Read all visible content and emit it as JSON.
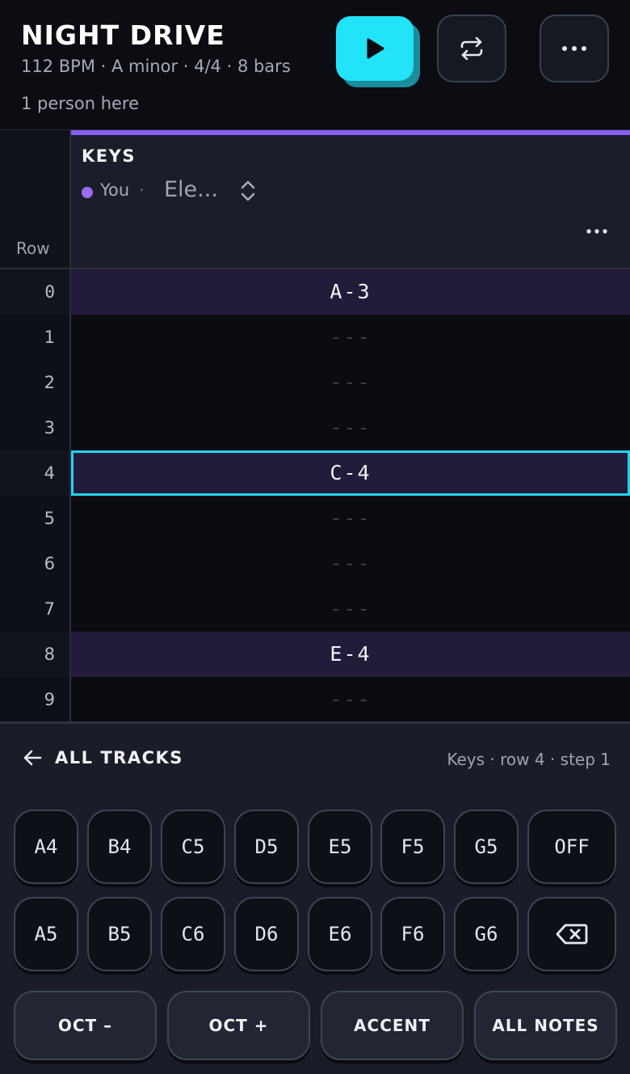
{
  "song": {
    "title": "NIGHT DRIVE",
    "meta": "112 BPM · A minor · 4/4 · 8 bars",
    "presence": "1 person here"
  },
  "header_buttons": {
    "play_icon": "play-icon",
    "loop_icon": "loop-icon",
    "more_icon": "more-icon"
  },
  "grid": {
    "row_header": "Row",
    "track": {
      "name": "KEYS",
      "owner": "You",
      "owner_separator": "·",
      "instrument": "Ele...",
      "color": "#8a5cf6"
    },
    "rows": [
      {
        "num": "0",
        "value": "A-3"
      },
      {
        "num": "1",
        "value": "---"
      },
      {
        "num": "2",
        "value": "---"
      },
      {
        "num": "3",
        "value": "---"
      },
      {
        "num": "4",
        "value": "C-4"
      },
      {
        "num": "5",
        "value": "---"
      },
      {
        "num": "6",
        "value": "---"
      },
      {
        "num": "7",
        "value": "---"
      },
      {
        "num": "8",
        "value": "E-4"
      },
      {
        "num": "9",
        "value": "---"
      }
    ]
  },
  "panel": {
    "back_label": "ALL TRACKS",
    "position_info": "Keys · row 4 · step 1",
    "keys_row1": [
      "A4",
      "B4",
      "C5",
      "D5",
      "E5",
      "F5",
      "G5",
      "OFF"
    ],
    "keys_row2": [
      "A5",
      "B5",
      "C6",
      "D6",
      "E6",
      "F6",
      "G6"
    ],
    "backspace_icon": "backspace-icon",
    "functions": [
      "OCT –",
      "OCT +",
      "ACCENT",
      "ALL NOTES"
    ]
  },
  "colors": {
    "accent": "#22e3f8",
    "track": "#8a5cf6",
    "note_cell": "#221b3a"
  }
}
